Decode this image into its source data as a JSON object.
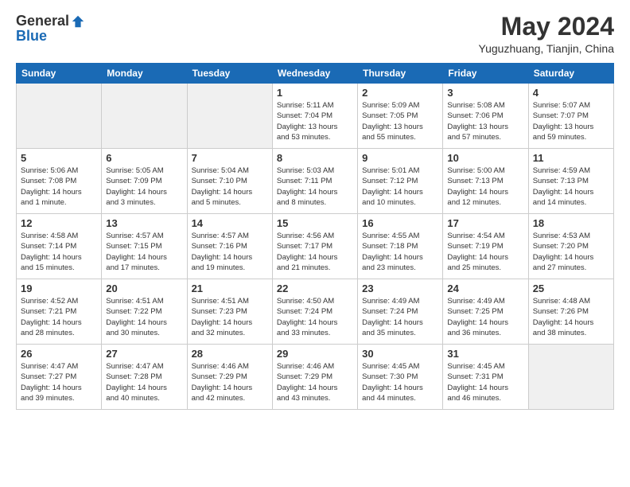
{
  "header": {
    "logo_line1": "General",
    "logo_line2": "Blue",
    "month_title": "May 2024",
    "location": "Yuguzhuang, Tianjin, China"
  },
  "weekdays": [
    "Sunday",
    "Monday",
    "Tuesday",
    "Wednesday",
    "Thursday",
    "Friday",
    "Saturday"
  ],
  "weeks": [
    [
      {
        "day": "",
        "info": ""
      },
      {
        "day": "",
        "info": ""
      },
      {
        "day": "",
        "info": ""
      },
      {
        "day": "1",
        "info": "Sunrise: 5:11 AM\nSunset: 7:04 PM\nDaylight: 13 hours\nand 53 minutes."
      },
      {
        "day": "2",
        "info": "Sunrise: 5:09 AM\nSunset: 7:05 PM\nDaylight: 13 hours\nand 55 minutes."
      },
      {
        "day": "3",
        "info": "Sunrise: 5:08 AM\nSunset: 7:06 PM\nDaylight: 13 hours\nand 57 minutes."
      },
      {
        "day": "4",
        "info": "Sunrise: 5:07 AM\nSunset: 7:07 PM\nDaylight: 13 hours\nand 59 minutes."
      }
    ],
    [
      {
        "day": "5",
        "info": "Sunrise: 5:06 AM\nSunset: 7:08 PM\nDaylight: 14 hours\nand 1 minute."
      },
      {
        "day": "6",
        "info": "Sunrise: 5:05 AM\nSunset: 7:09 PM\nDaylight: 14 hours\nand 3 minutes."
      },
      {
        "day": "7",
        "info": "Sunrise: 5:04 AM\nSunset: 7:10 PM\nDaylight: 14 hours\nand 5 minutes."
      },
      {
        "day": "8",
        "info": "Sunrise: 5:03 AM\nSunset: 7:11 PM\nDaylight: 14 hours\nand 8 minutes."
      },
      {
        "day": "9",
        "info": "Sunrise: 5:01 AM\nSunset: 7:12 PM\nDaylight: 14 hours\nand 10 minutes."
      },
      {
        "day": "10",
        "info": "Sunrise: 5:00 AM\nSunset: 7:13 PM\nDaylight: 14 hours\nand 12 minutes."
      },
      {
        "day": "11",
        "info": "Sunrise: 4:59 AM\nSunset: 7:13 PM\nDaylight: 14 hours\nand 14 minutes."
      }
    ],
    [
      {
        "day": "12",
        "info": "Sunrise: 4:58 AM\nSunset: 7:14 PM\nDaylight: 14 hours\nand 15 minutes."
      },
      {
        "day": "13",
        "info": "Sunrise: 4:57 AM\nSunset: 7:15 PM\nDaylight: 14 hours\nand 17 minutes."
      },
      {
        "day": "14",
        "info": "Sunrise: 4:57 AM\nSunset: 7:16 PM\nDaylight: 14 hours\nand 19 minutes."
      },
      {
        "day": "15",
        "info": "Sunrise: 4:56 AM\nSunset: 7:17 PM\nDaylight: 14 hours\nand 21 minutes."
      },
      {
        "day": "16",
        "info": "Sunrise: 4:55 AM\nSunset: 7:18 PM\nDaylight: 14 hours\nand 23 minutes."
      },
      {
        "day": "17",
        "info": "Sunrise: 4:54 AM\nSunset: 7:19 PM\nDaylight: 14 hours\nand 25 minutes."
      },
      {
        "day": "18",
        "info": "Sunrise: 4:53 AM\nSunset: 7:20 PM\nDaylight: 14 hours\nand 27 minutes."
      }
    ],
    [
      {
        "day": "19",
        "info": "Sunrise: 4:52 AM\nSunset: 7:21 PM\nDaylight: 14 hours\nand 28 minutes."
      },
      {
        "day": "20",
        "info": "Sunrise: 4:51 AM\nSunset: 7:22 PM\nDaylight: 14 hours\nand 30 minutes."
      },
      {
        "day": "21",
        "info": "Sunrise: 4:51 AM\nSunset: 7:23 PM\nDaylight: 14 hours\nand 32 minutes."
      },
      {
        "day": "22",
        "info": "Sunrise: 4:50 AM\nSunset: 7:24 PM\nDaylight: 14 hours\nand 33 minutes."
      },
      {
        "day": "23",
        "info": "Sunrise: 4:49 AM\nSunset: 7:24 PM\nDaylight: 14 hours\nand 35 minutes."
      },
      {
        "day": "24",
        "info": "Sunrise: 4:49 AM\nSunset: 7:25 PM\nDaylight: 14 hours\nand 36 minutes."
      },
      {
        "day": "25",
        "info": "Sunrise: 4:48 AM\nSunset: 7:26 PM\nDaylight: 14 hours\nand 38 minutes."
      }
    ],
    [
      {
        "day": "26",
        "info": "Sunrise: 4:47 AM\nSunset: 7:27 PM\nDaylight: 14 hours\nand 39 minutes."
      },
      {
        "day": "27",
        "info": "Sunrise: 4:47 AM\nSunset: 7:28 PM\nDaylight: 14 hours\nand 40 minutes."
      },
      {
        "day": "28",
        "info": "Sunrise: 4:46 AM\nSunset: 7:29 PM\nDaylight: 14 hours\nand 42 minutes."
      },
      {
        "day": "29",
        "info": "Sunrise: 4:46 AM\nSunset: 7:29 PM\nDaylight: 14 hours\nand 43 minutes."
      },
      {
        "day": "30",
        "info": "Sunrise: 4:45 AM\nSunset: 7:30 PM\nDaylight: 14 hours\nand 44 minutes."
      },
      {
        "day": "31",
        "info": "Sunrise: 4:45 AM\nSunset: 7:31 PM\nDaylight: 14 hours\nand 46 minutes."
      },
      {
        "day": "",
        "info": ""
      }
    ]
  ]
}
